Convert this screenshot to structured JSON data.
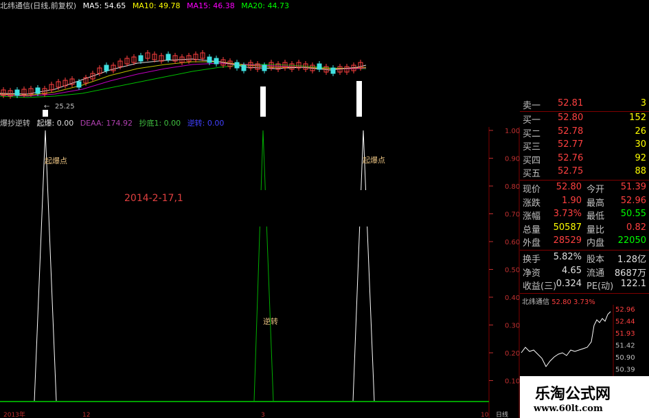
{
  "header": {
    "stock_name": "北纬通信(日线,前复权)",
    "ma5": "MA5: 54.65",
    "ma10": "MA10: 49.78",
    "ma15": "MA15: 46.38",
    "ma20": "MA20: 44.73",
    "colors": {
      "ma5": "#ffffff",
      "ma10": "#ffff00",
      "ma15": "#ff00ff",
      "ma20": "#00ff00"
    }
  },
  "price_chart": {
    "low_marker": "25.25"
  },
  "indicator": {
    "name": "爆抄逆转",
    "qibao": "起爆: 0.00",
    "deaa": "DEAA: 174.92",
    "chaodi": "抄底1: 0.00",
    "nizhuan": "逆转: 0.00",
    "label_qibao_1": "起爆点",
    "label_qibao_2": "起爆点",
    "label_nizhuan": "逆转",
    "date_text": "2014-2-17,1",
    "y_ticks": [
      "1.00",
      "0.90",
      "0.80",
      "0.70",
      "0.60",
      "0.50",
      "0.40",
      "0.30",
      "0.20",
      "0.10"
    ],
    "x_ticks": [
      "2013年",
      "12",
      "3",
      "10",
      "日线"
    ]
  },
  "quotes": {
    "sell1": {
      "label": "卖一",
      "price": "52.81",
      "vol": "3"
    },
    "buy": [
      {
        "label": "买一",
        "price": "52.80",
        "vol": "152"
      },
      {
        "label": "买二",
        "price": "52.78",
        "vol": "26"
      },
      {
        "label": "买三",
        "price": "52.77",
        "vol": "30"
      },
      {
        "label": "买四",
        "price": "52.76",
        "vol": "92"
      },
      {
        "label": "买五",
        "price": "52.75",
        "vol": "88"
      }
    ],
    "stats": [
      {
        "l1": "现价",
        "v1": "52.80",
        "l2": "今开",
        "v2": "51.39"
      },
      {
        "l1": "涨跌",
        "v1": "1.90",
        "l2": "最高",
        "v2": "52.96"
      },
      {
        "l1": "涨幅",
        "v1": "3.73%",
        "l2": "最低",
        "v2": "50.55"
      },
      {
        "l1": "总量",
        "v1": "50587",
        "l2": "量比",
        "v2": "0.82"
      },
      {
        "l1": "外盘",
        "v1": "28529",
        "l2": "内盘",
        "v2": "22050"
      }
    ],
    "finance": [
      {
        "l1": "换手",
        "v1": "5.82%",
        "l2": "股本",
        "v2": "1.28亿"
      },
      {
        "l1": "净资",
        "v1": "4.65",
        "l2": "流通",
        "v2": "8687万"
      },
      {
        "l1": "收益(三)",
        "v1": "0.324",
        "l2": "PE(动)",
        "v2": "122.1"
      }
    ]
  },
  "mini_chart": {
    "title": "北纬通信",
    "price": "52.80",
    "pct": "3.73%",
    "axis": [
      "52.96",
      "52.44",
      "51.93",
      "51.42",
      "50.90",
      "50.39"
    ]
  },
  "logo": {
    "text": "乐淘公式网",
    "url": "www.60lt.com"
  }
}
